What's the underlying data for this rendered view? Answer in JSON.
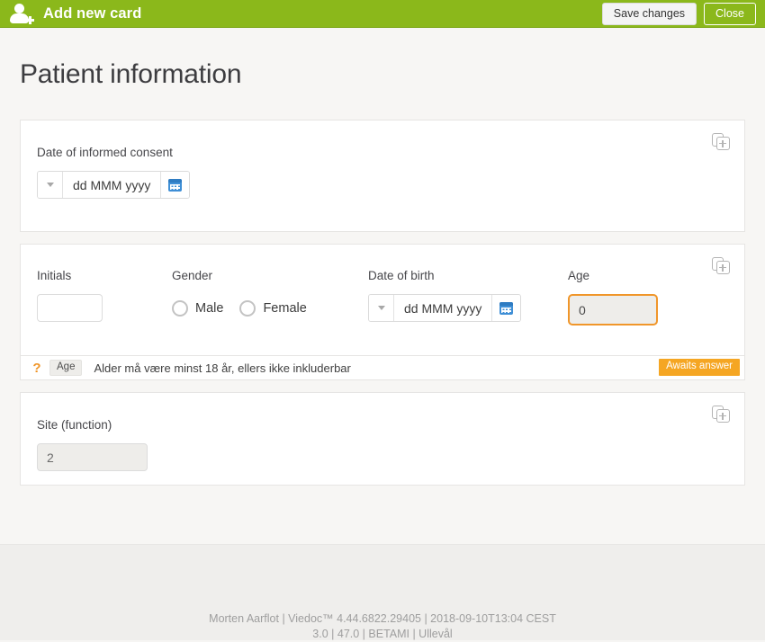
{
  "topbar": {
    "icon": "add-user-icon",
    "title": "Add new card",
    "save_label": "Save changes",
    "close_label": "Close",
    "background_color": "#8bb81b"
  },
  "page": {
    "title": "Patient information"
  },
  "cards": {
    "consent": {
      "copy_icon": "copy-add-icon",
      "label": "Date of informed consent",
      "date_placeholder": "dd MMM yyyy",
      "caret_icon": "chevron-down-icon",
      "calendar_icon": "calendar-icon"
    },
    "demographics": {
      "copy_icon": "copy-add-icon",
      "initials_label": "Initials",
      "initials_value": "",
      "gender_label": "Gender",
      "gender_options": [
        {
          "label": "Male",
          "selected": false
        },
        {
          "label": "Female",
          "selected": false
        }
      ],
      "dob_label": "Date of birth",
      "dob_placeholder": "dd MMM yyyy",
      "age_label": "Age",
      "age_value": "0",
      "age_highlight_color": "#f0962a"
    },
    "validation": {
      "query_icon": "question-icon",
      "tag": "Age",
      "message": "Alder må være minst 18 år, ellers ikke inkluderbar",
      "badge": "Awaits answer",
      "badge_color": "#f5a623"
    },
    "site": {
      "copy_icon": "copy-add-icon",
      "label": "Site (function)",
      "value": "2"
    }
  },
  "footer": {
    "line1": "Morten Aarflot | Viedoc™ 4.44.6822.29405 | 2018-09-10T13:04 CEST",
    "line2": "3.0 | 47.0 | BETAMI | Ullevål"
  }
}
